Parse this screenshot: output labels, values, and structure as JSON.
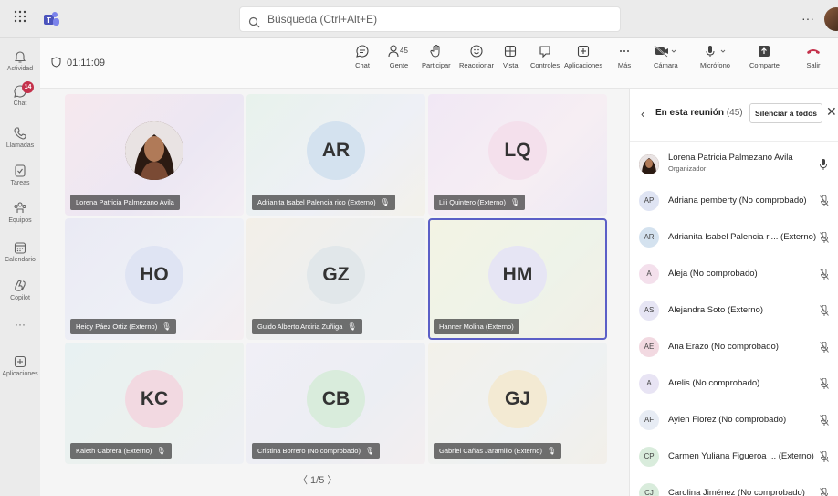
{
  "topbar": {
    "search_placeholder": "Búsqueda (Ctrl+Alt+E)",
    "more": "···"
  },
  "rail": {
    "items": [
      {
        "label": "Actividad",
        "icon": "bell-icon"
      },
      {
        "label": "Chat",
        "icon": "chat-icon",
        "badge": "14"
      },
      {
        "label": "Llamadas",
        "icon": "phone-icon"
      },
      {
        "label": "Tareas",
        "icon": "tasks-icon"
      },
      {
        "label": "Equipos",
        "icon": "teams-icon"
      },
      {
        "label": "Calendario",
        "icon": "calendar-icon"
      },
      {
        "label": "Copilot",
        "icon": "copilot-icon"
      },
      {
        "label": "···",
        "icon": "more-icon"
      },
      {
        "label": "Aplicaciones",
        "icon": "apps-icon"
      }
    ]
  },
  "meeting": {
    "timer": "01:11:09",
    "people_count": "45",
    "buttons": {
      "chat": "Chat",
      "gente": "Gente",
      "participar": "Participar",
      "reaccionar": "Reaccionar",
      "vista": "Vista",
      "controles": "Controles",
      "aplicaciones": "Aplicaciones",
      "mas": "Más",
      "camara": "Cámara",
      "microfono": "Micrófono",
      "comparte": "Comparte",
      "salir": "Salir"
    }
  },
  "tiles": [
    {
      "initials": "",
      "name": "Lorena Patricia Palmezano Avila",
      "muted": false,
      "photo": true
    },
    {
      "initials": "AR",
      "name": "Adrianita Isabel Palencia rico (Externo)",
      "muted": true
    },
    {
      "initials": "LQ",
      "name": "Lili Quintero (Externo)",
      "muted": true
    },
    {
      "initials": "HO",
      "name": "Heidy Páez Ortiz (Externo)",
      "muted": true
    },
    {
      "initials": "GZ",
      "name": "Guido Alberto Arciria Zuñiga",
      "muted": true
    },
    {
      "initials": "HM",
      "name": "Hanner Molina (Externo)",
      "muted": false,
      "active": true
    },
    {
      "initials": "KC",
      "name": "Kaleth Cabrera (Externo)",
      "muted": true
    },
    {
      "initials": "CB",
      "name": "Cristina Borrero (No comprobado)",
      "muted": true
    },
    {
      "initials": "GJ",
      "name": "Gabriel Cañas Jaramillo (Externo)",
      "muted": true
    }
  ],
  "pager": "〈  1/5  〉",
  "panel": {
    "title": "En esta reunión",
    "count": "(45)",
    "mute_all": "Silenciar a todos",
    "people": [
      {
        "initials": "",
        "name": "Lorena Patricia Palmezano Avila",
        "role": "Organizador",
        "photo": true
      },
      {
        "initials": "AP",
        "name": "Adriana pemberty (No comprobado)"
      },
      {
        "initials": "AR",
        "name": "Adrianita Isabel Palencia ri... (Externo)"
      },
      {
        "initials": "A",
        "name": "Aleja (No comprobado)"
      },
      {
        "initials": "AS",
        "name": "Alejandra Soto (Externo)"
      },
      {
        "initials": "AE",
        "name": "Ana Erazo (No comprobado)"
      },
      {
        "initials": "A",
        "name": "Arelis (No comprobado)"
      },
      {
        "initials": "AF",
        "name": "Aylen Florez (No comprobado)"
      },
      {
        "initials": "CP",
        "name": "Carmen Yuliana Figueroa ... (Externo)"
      },
      {
        "initials": "CJ",
        "name": "Carolina Jiménez (No comprobado)"
      }
    ]
  }
}
